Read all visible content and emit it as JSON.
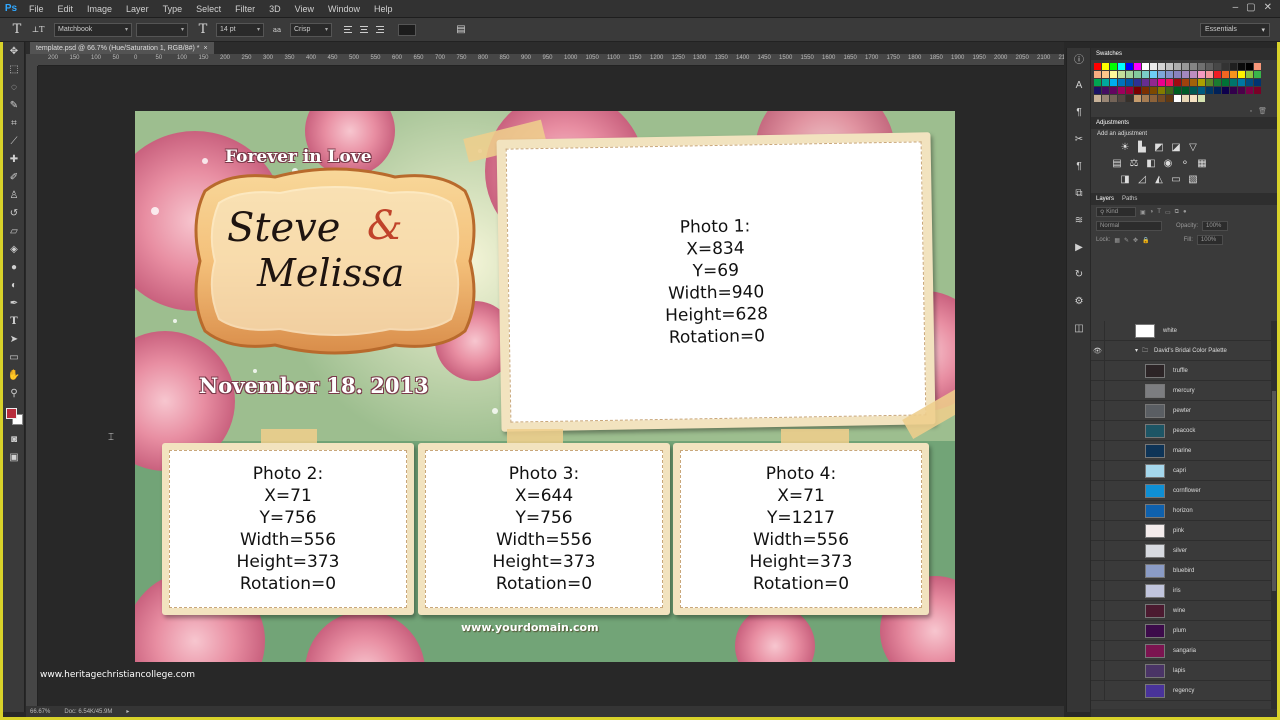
{
  "app": {
    "logo": "Ps"
  },
  "menu": [
    "File",
    "Edit",
    "Image",
    "Layer",
    "Type",
    "Select",
    "Filter",
    "3D",
    "View",
    "Window",
    "Help"
  ],
  "window_controls": [
    "–",
    "▢",
    "✕"
  ],
  "options": {
    "tool_icon": "T",
    "orient_icon": "⊥T",
    "font_family": "Matchbook",
    "font_style": "",
    "size_icon": "T",
    "font_size": "14 pt",
    "aa_icon": "aa",
    "antialias": "Crisp",
    "color_swatch": "#1c1c1c",
    "workspace": "Essentials"
  },
  "document": {
    "tab_title": "template.psd @ 66.7% (Hue/Saturation 1, RGB/8#) *",
    "close": "×",
    "zoom": "66.67%",
    "doc_size": "Doc: 6.54K/45.9M",
    "tagline": "Forever in Love",
    "name_first": "Steve",
    "ampersand": "&",
    "name_second": "Melissa",
    "date": "November 18. 2013",
    "domain": "www.yourdomain.com",
    "photos": [
      {
        "lines": [
          "Photo 1:",
          "X=834",
          "Y=69",
          "Width=940",
          "Height=628",
          "Rotation=0"
        ]
      },
      {
        "lines": [
          "Photo 2:",
          "X=71",
          "Y=756",
          "Width=556",
          "Height=373",
          "Rotation=0"
        ]
      },
      {
        "lines": [
          "Photo 3:",
          "X=644",
          "Y=756",
          "Width=556",
          "Height=373",
          "Rotation=0"
        ]
      },
      {
        "lines": [
          "Photo 4:",
          "X=71",
          "Y=1217",
          "Width=556",
          "Height=373",
          "Rotation=0"
        ]
      }
    ]
  },
  "watermark": "www.heritagechristiancollege.com",
  "ruler_labels": [
    "200",
    "150",
    "100",
    "50",
    "0",
    "50",
    "100",
    "150",
    "200",
    "250",
    "300",
    "350",
    "400",
    "450",
    "500",
    "550",
    "600",
    "650",
    "700",
    "750",
    "800",
    "850",
    "900",
    "950",
    "1000",
    "1050",
    "1100",
    "1150",
    "1200",
    "1250",
    "1300",
    "1350",
    "1400",
    "1450",
    "1500",
    "1550",
    "1600",
    "1650",
    "1700",
    "1750",
    "1800",
    "1850",
    "1900",
    "1950",
    "2000",
    "2050",
    "2100",
    "2150",
    "2200"
  ],
  "panels": {
    "swatches_tab": "Swatches",
    "adjustments_tab": "Adjustments",
    "adjustments_subtitle": "Add an adjustment",
    "layers_tab": "Layers",
    "paths_tab": "Paths",
    "kind_label": "Kind",
    "blend_mode": "Normal",
    "opacity_label": "Opacity:",
    "opacity_value": "100%",
    "lock_label": "Lock:",
    "fill_label": "Fill:",
    "fill_value": "100%"
  },
  "swatch_colors": [
    "#ff0000",
    "#ffff00",
    "#00ff00",
    "#00ffff",
    "#0000ff",
    "#ff00ff",
    "#ffffff",
    "#ebebeb",
    "#d6d6d6",
    "#c2c2c2",
    "#adadad",
    "#999999",
    "#858585",
    "#707070",
    "#5c5c5c",
    "#474747",
    "#333333",
    "#1f1f1f",
    "#0a0a0a",
    "#000000",
    "#f7977a",
    "#f9ad81",
    "#fdc68a",
    "#fff79a",
    "#c4df9b",
    "#a3d39c",
    "#82ca9d",
    "#7bcdc8",
    "#6ecff6",
    "#7ea7d8",
    "#8493ca",
    "#8882be",
    "#a187be",
    "#bc8dbf",
    "#f49ac2",
    "#f6989d",
    "#ed1c24",
    "#f26522",
    "#f7941d",
    "#fff200",
    "#8dc63f",
    "#39b54a",
    "#00a651",
    "#00a99d",
    "#00aeef",
    "#0072bc",
    "#0054a6",
    "#2e3192",
    "#662d91",
    "#92278f",
    "#ec008c",
    "#ed145b",
    "#9e0b0f",
    "#a0410d",
    "#a36209",
    "#aba000",
    "#598527",
    "#1a7b30",
    "#007236",
    "#00746b",
    "#0076a3",
    "#004b80",
    "#003471",
    "#1b1464",
    "#440e62",
    "#630460",
    "#9e005d",
    "#9e0039",
    "#790000",
    "#7b2e00",
    "#7d4900",
    "#827b00",
    "#406618",
    "#005e20",
    "#005826",
    "#005952",
    "#005b7f",
    "#003663",
    "#002157",
    "#0d004c",
    "#32004b",
    "#4b0049",
    "#7b0046",
    "#7a0026",
    "#c7b299",
    "#998675",
    "#736357",
    "#534741",
    "#37302a",
    "#c69c6d",
    "#a67c52",
    "#8c6239",
    "#754c24",
    "#603913",
    "#ffffff",
    "#e8d6b5",
    "#f6e3c4",
    "#d5e3b0"
  ],
  "layers": [
    {
      "name": "white",
      "color": "#ffffff",
      "kind": "top",
      "eye": ""
    },
    {
      "name": "David's Bridal Color Palette",
      "color": "",
      "kind": "group",
      "eye": "👁"
    },
    {
      "name": "truffle",
      "color": "#2c2426",
      "kind": "indent",
      "eye": ""
    },
    {
      "name": "mercury",
      "color": "#7c7d80",
      "kind": "indent",
      "eye": ""
    },
    {
      "name": "pewter",
      "color": "#5a5e63",
      "kind": "indent",
      "eye": ""
    },
    {
      "name": "peacock",
      "color": "#1d5565",
      "kind": "indent",
      "eye": ""
    },
    {
      "name": "marine",
      "color": "#0e3457",
      "kind": "indent",
      "eye": ""
    },
    {
      "name": "capri",
      "color": "#a5d7ec",
      "kind": "indent",
      "eye": ""
    },
    {
      "name": "cornflower",
      "color": "#0f8fd4",
      "kind": "indent",
      "eye": ""
    },
    {
      "name": "horizon",
      "color": "#0f61ad",
      "kind": "indent",
      "eye": ""
    },
    {
      "name": "pink",
      "color": "#f4ecec",
      "kind": "indent",
      "eye": ""
    },
    {
      "name": "silver",
      "color": "#d7dae0",
      "kind": "indent",
      "eye": ""
    },
    {
      "name": "bluebird",
      "color": "#8b9cc6",
      "kind": "indent",
      "eye": ""
    },
    {
      "name": "iris",
      "color": "#c1c5dd",
      "kind": "indent",
      "eye": ""
    },
    {
      "name": "wine",
      "color": "#4b1a30",
      "kind": "indent",
      "eye": ""
    },
    {
      "name": "plum",
      "color": "#3c0b4a",
      "kind": "indent",
      "eye": ""
    },
    {
      "name": "sangaria",
      "color": "#7b1450",
      "kind": "indent",
      "eye": ""
    },
    {
      "name": "lapis",
      "color": "#4a3466",
      "kind": "indent",
      "eye": ""
    },
    {
      "name": "regency",
      "color": "#49339a",
      "kind": "indent",
      "eye": ""
    }
  ]
}
